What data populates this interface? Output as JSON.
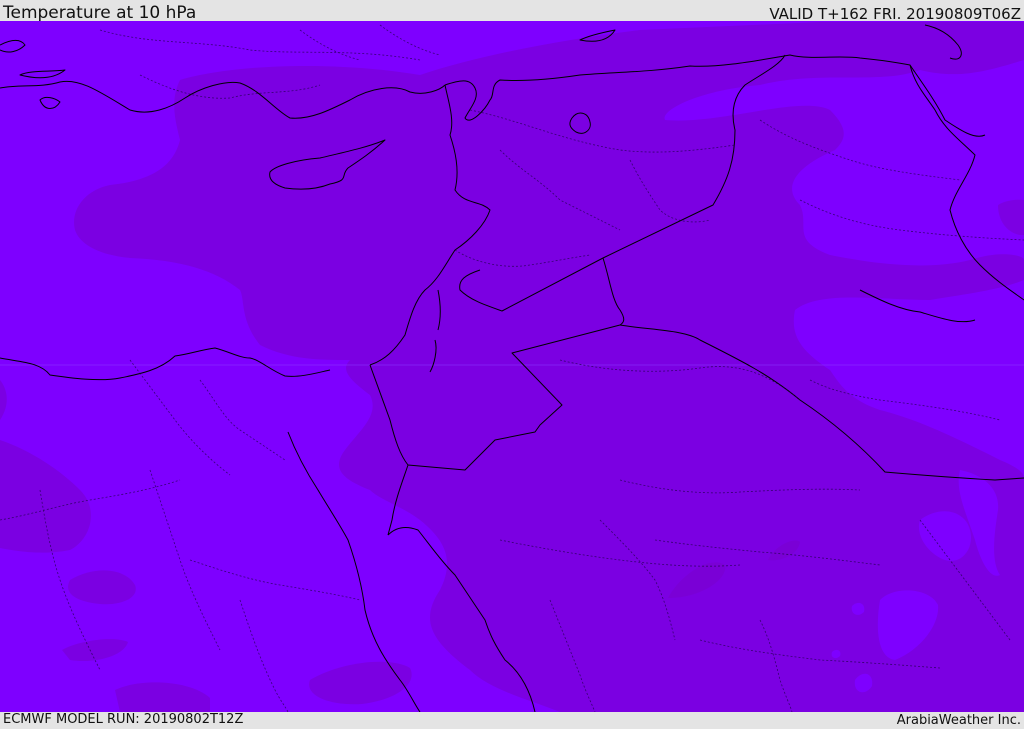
{
  "header": {
    "title": "Temperature at 10 hPa",
    "valid": "VALID T+162 FRI. 20190809T06Z"
  },
  "footer": {
    "model_run": "ECMWF MODEL RUN: 20190802T12Z",
    "credit": "ArabiaWeather Inc."
  },
  "map": {
    "colors": {
      "field_light": "#7e00ff",
      "field_dark": "#7b00e2",
      "outline": "#000000"
    },
    "icons": [
      "coastline-lines",
      "country-borders",
      "province-borders"
    ]
  }
}
